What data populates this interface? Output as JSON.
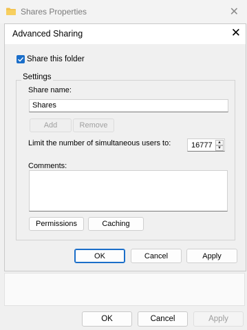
{
  "outer_window": {
    "title": "Shares Properties",
    "close_glyph": "✕",
    "icons": {
      "title": "folder-icon",
      "close": "close-icon"
    },
    "buttons": {
      "ok": "OK",
      "cancel": "Cancel",
      "apply": "Apply"
    }
  },
  "dialog": {
    "title": "Advanced Sharing",
    "close_glyph": "✕",
    "share_checkbox": {
      "label": "Share this folder",
      "checked": true
    },
    "settings": {
      "group_label": "Settings",
      "share_name_label": "Share name:",
      "share_name_value": "Shares",
      "add_label": "Add",
      "remove_label": "Remove",
      "limit_label": "Limit the number of simultaneous users to:",
      "limit_value": "16777",
      "spin_up": "▲",
      "spin_down": "▼",
      "comments_label": "Comments:",
      "comments_value": "",
      "permissions_label": "Permissions",
      "caching_label": "Caching"
    },
    "buttons": {
      "ok": "OK",
      "cancel": "Cancel",
      "apply": "Apply"
    }
  },
  "colors": {
    "accent": "#1a6ec9",
    "folder": "#f2c14e",
    "background": "#f0f0f0"
  }
}
